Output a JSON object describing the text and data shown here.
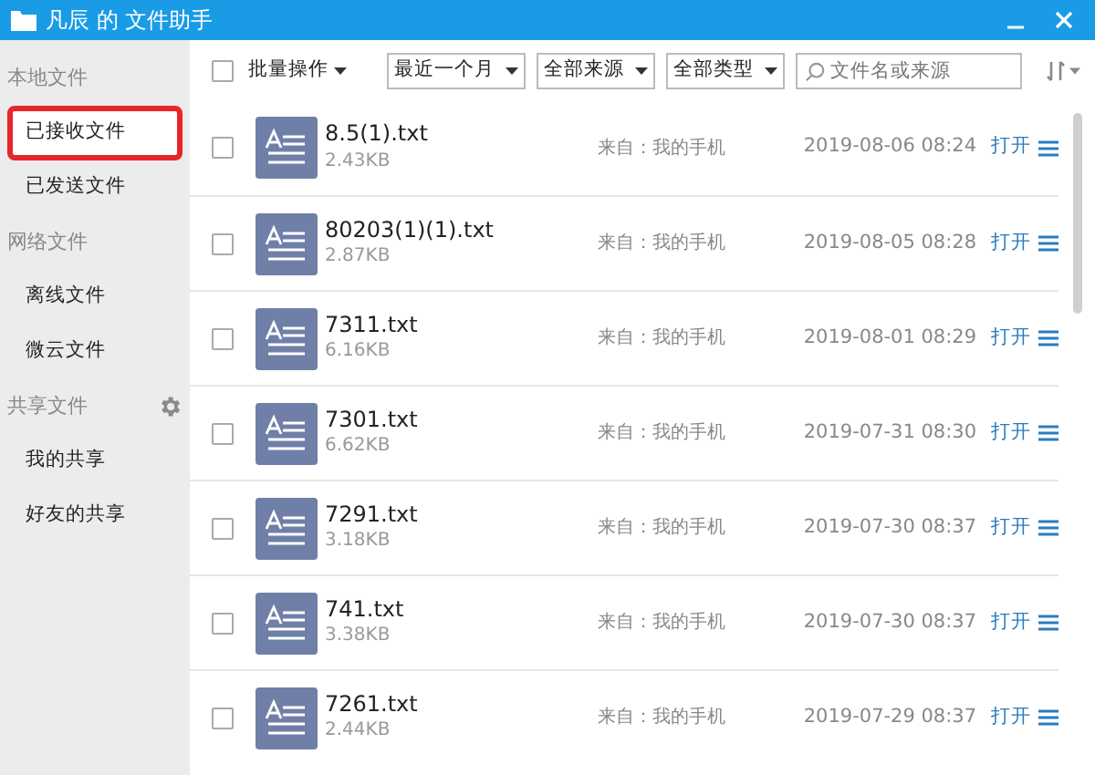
{
  "window": {
    "title": "凡辰 的 文件助手"
  },
  "sidebar": {
    "sections": [
      {
        "title": "本地文件",
        "has_settings": false,
        "items": [
          {
            "label": "已接收文件",
            "selected": true
          },
          {
            "label": "已发送文件",
            "selected": false
          }
        ]
      },
      {
        "title": "网络文件",
        "has_settings": false,
        "items": [
          {
            "label": "离线文件",
            "selected": false
          },
          {
            "label": "微云文件",
            "selected": false
          }
        ]
      },
      {
        "title": "共享文件",
        "has_settings": true,
        "items": [
          {
            "label": "我的共享",
            "selected": false
          },
          {
            "label": "好友的共享",
            "selected": false
          }
        ]
      }
    ]
  },
  "toolbar": {
    "select_all": {
      "checked": false
    },
    "batch_label": "批量操作",
    "filters": [
      "最近一个月",
      "全部来源",
      "全部类型"
    ],
    "search": {
      "placeholder": "文件名或来源"
    }
  },
  "files": [
    {
      "name": "8.5(1).txt",
      "size": "2.43KB",
      "source": "来自：我的手机",
      "date": "2019-08-06 08:24",
      "action": "打开",
      "checked": false
    },
    {
      "name": "80203(1)(1).txt",
      "size": "2.87KB",
      "source": "来自：我的手机",
      "date": "2019-08-05 08:28",
      "action": "打开",
      "checked": false
    },
    {
      "name": "7311.txt",
      "size": "6.16KB",
      "source": "来自：我的手机",
      "date": "2019-08-01 08:29",
      "action": "打开",
      "checked": false
    },
    {
      "name": "7301.txt",
      "size": "6.62KB",
      "source": "来自：我的手机",
      "date": "2019-07-31 08:30",
      "action": "打开",
      "checked": false
    },
    {
      "name": "7291.txt",
      "size": "3.18KB",
      "source": "来自：我的手机",
      "date": "2019-07-30 08:37",
      "action": "打开",
      "checked": false
    },
    {
      "name": "741.txt",
      "size": "3.38KB",
      "source": "来自：我的手机",
      "date": "2019-07-30 08:37",
      "action": "打开",
      "checked": false
    },
    {
      "name": "7261.txt",
      "size": "2.44KB",
      "source": "来自：我的手机",
      "date": "2019-07-29 08:37",
      "action": "打开",
      "checked": false
    }
  ]
}
